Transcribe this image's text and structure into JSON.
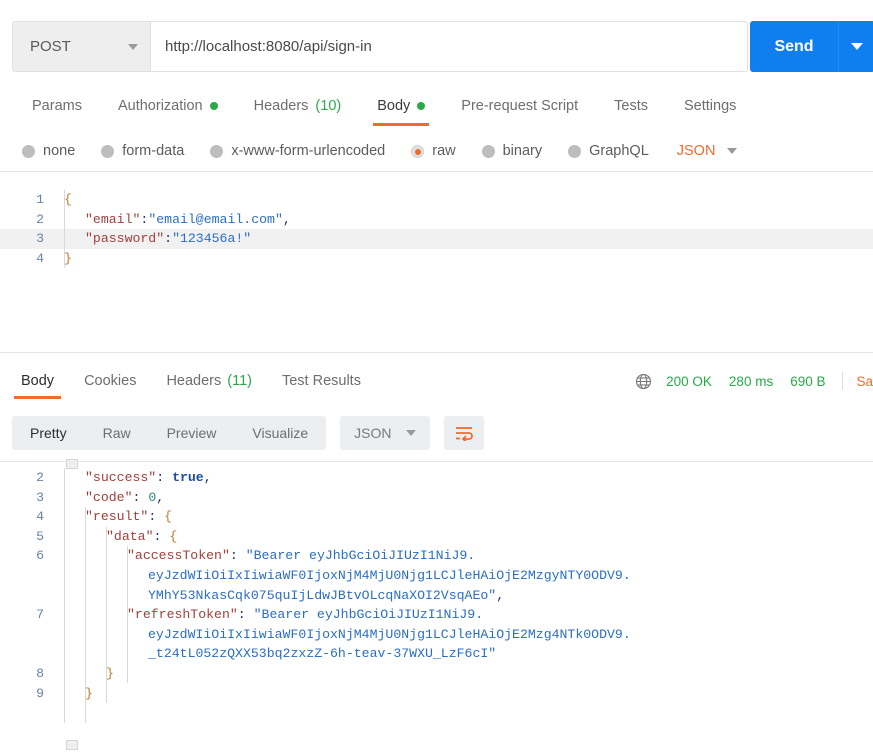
{
  "request": {
    "method": "POST",
    "url": "http://localhost:8080/api/sign-in",
    "send_label": "Send",
    "tabs": [
      {
        "label": "Params",
        "dot": false,
        "count": "",
        "active": false
      },
      {
        "label": "Authorization",
        "dot": true,
        "count": "",
        "active": false
      },
      {
        "label": "Headers",
        "dot": false,
        "count": "(10)",
        "active": false
      },
      {
        "label": "Body",
        "dot": true,
        "count": "",
        "active": true
      },
      {
        "label": "Pre-request Script",
        "dot": false,
        "count": "",
        "active": false
      },
      {
        "label": "Tests",
        "dot": false,
        "count": "",
        "active": false
      },
      {
        "label": "Settings",
        "dot": false,
        "count": "",
        "active": false
      }
    ],
    "body_types": [
      {
        "label": "none",
        "selected": false
      },
      {
        "label": "form-data",
        "selected": false
      },
      {
        "label": "x-www-form-urlencoded",
        "selected": false
      },
      {
        "label": "raw",
        "selected": true
      },
      {
        "label": "binary",
        "selected": false
      },
      {
        "label": "GraphQL",
        "selected": false
      }
    ],
    "raw_format": "JSON",
    "body_lines": [
      {
        "n": "1",
        "parts": [
          {
            "t": "{",
            "c": "br"
          }
        ],
        "indent": 0,
        "hl": false
      },
      {
        "n": "2",
        "parts": [
          {
            "t": "\"email\"",
            "c": "k"
          },
          {
            "t": ":",
            "c": "p"
          },
          {
            "t": "\"email@email.com\"",
            "c": "s"
          },
          {
            "t": ",",
            "c": "p"
          }
        ],
        "indent": 1,
        "hl": false
      },
      {
        "n": "3",
        "parts": [
          {
            "t": "\"password\"",
            "c": "k"
          },
          {
            "t": ":",
            "c": "p"
          },
          {
            "t": "\"123456a!\"",
            "c": "s"
          }
        ],
        "indent": 1,
        "hl": true
      },
      {
        "n": "4",
        "parts": [
          {
            "t": "}",
            "c": "br"
          }
        ],
        "indent": 0,
        "hl": false
      }
    ]
  },
  "response": {
    "tabs": [
      {
        "label": "Body",
        "count": "",
        "active": true
      },
      {
        "label": "Cookies",
        "count": "",
        "active": false
      },
      {
        "label": "Headers",
        "count": "(11)",
        "active": false
      },
      {
        "label": "Test Results",
        "count": "",
        "active": false
      }
    ],
    "status": "200 OK",
    "time": "280 ms",
    "size": "690 B",
    "save_response": "Sa",
    "view_modes": [
      {
        "label": "Pretty",
        "active": true
      },
      {
        "label": "Raw",
        "active": false
      },
      {
        "label": "Preview",
        "active": false
      },
      {
        "label": "Visualize",
        "active": false
      }
    ],
    "language": "JSON",
    "body_lines": [
      {
        "n": "2",
        "indent": 1,
        "parts": [
          {
            "t": "\"success\"",
            "c": "k"
          },
          {
            "t": ": ",
            "c": "p"
          },
          {
            "t": "true",
            "c": "bl"
          },
          {
            "t": ",",
            "c": "p"
          }
        ]
      },
      {
        "n": "3",
        "indent": 1,
        "parts": [
          {
            "t": "\"code\"",
            "c": "k"
          },
          {
            "t": ": ",
            "c": "p"
          },
          {
            "t": "0",
            "c": "nm"
          },
          {
            "t": ",",
            "c": "p"
          }
        ]
      },
      {
        "n": "4",
        "indent": 1,
        "parts": [
          {
            "t": "\"result\"",
            "c": "k"
          },
          {
            "t": ": ",
            "c": "p"
          },
          {
            "t": "{",
            "c": "br"
          }
        ]
      },
      {
        "n": "5",
        "indent": 2,
        "parts": [
          {
            "t": "\"data\"",
            "c": "k"
          },
          {
            "t": ": ",
            "c": "p"
          },
          {
            "t": "{",
            "c": "br"
          }
        ]
      },
      {
        "n": "6",
        "indent": 3,
        "parts": [
          {
            "t": "\"accessToken\"",
            "c": "k"
          },
          {
            "t": ": ",
            "c": "p"
          },
          {
            "t": "\"Bearer eyJhbGciOiJIUzI1NiJ9.",
            "c": "s"
          }
        ]
      },
      {
        "n": "",
        "indent": 4,
        "parts": [
          {
            "t": "eyJzdWIiOiIxIiwiaWF0IjoxNjM4MjU0Njg1LCJleHAiOjE2MzgyNTY0ODV9.",
            "c": "s"
          }
        ]
      },
      {
        "n": "",
        "indent": 4,
        "parts": [
          {
            "t": "YMhY53NkasCqk075quIjLdwJBtvOLcqNaXOI2VsqAEo\"",
            "c": "s"
          },
          {
            "t": ",",
            "c": "p"
          }
        ]
      },
      {
        "n": "7",
        "indent": 3,
        "parts": [
          {
            "t": "\"refreshToken\"",
            "c": "k"
          },
          {
            "t": ": ",
            "c": "p"
          },
          {
            "t": "\"Bearer eyJhbGciOiJIUzI1NiJ9.",
            "c": "s"
          }
        ]
      },
      {
        "n": "",
        "indent": 4,
        "parts": [
          {
            "t": "eyJzdWIiOiIxIiwiaWF0IjoxNjM4MjU0Njg1LCJleHAiOjE2Mzg4NTk0ODV9.",
            "c": "s"
          }
        ]
      },
      {
        "n": "",
        "indent": 4,
        "parts": [
          {
            "t": "_t24tL052zQXX53bq2zxzZ-6h-teav-37WXU_LzF6cI\"",
            "c": "s"
          }
        ]
      },
      {
        "n": "8",
        "indent": 2,
        "parts": [
          {
            "t": "}",
            "c": "br"
          }
        ]
      },
      {
        "n": "9",
        "indent": 1,
        "parts": [
          {
            "t": "}",
            "c": "br"
          }
        ]
      }
    ]
  },
  "colors": {
    "accent_orange": "#ef6c2e",
    "send_blue": "#0f7ff0",
    "status_green": "#2aa84a"
  }
}
